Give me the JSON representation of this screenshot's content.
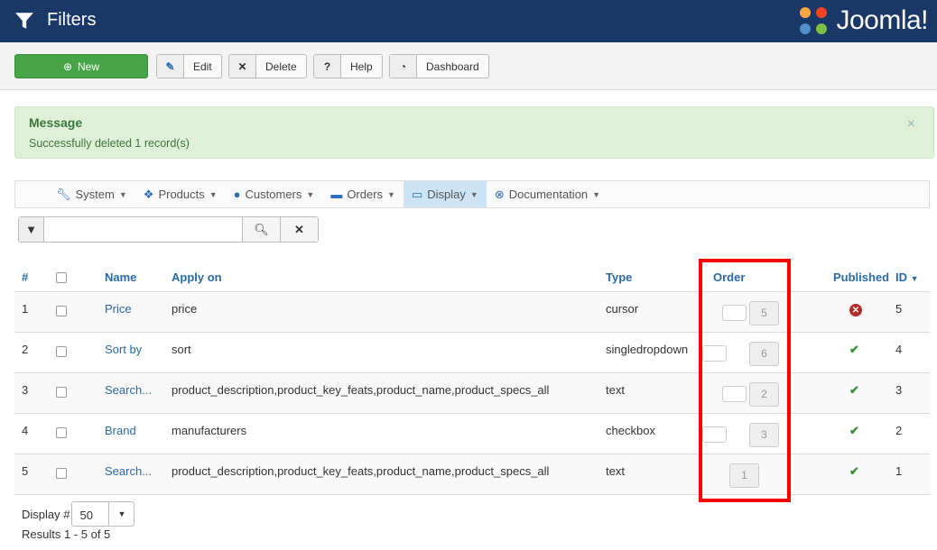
{
  "header": {
    "title": "Filters",
    "logo_text": "Joomla!"
  },
  "toolbar": {
    "new": "New",
    "edit": "Edit",
    "delete": "Delete",
    "help": "Help",
    "dashboard": "Dashboard"
  },
  "message": {
    "heading": "Message",
    "body": "Successfully deleted 1 record(s)",
    "close": "×"
  },
  "nav": [
    {
      "label": "System",
      "icon": "wrench-icon"
    },
    {
      "label": "Products",
      "icon": "cubes-icon"
    },
    {
      "label": "Customers",
      "icon": "user-icon"
    },
    {
      "label": "Orders",
      "icon": "credit-card-icon"
    },
    {
      "label": "Display",
      "icon": "monitor-icon",
      "active": true
    },
    {
      "label": "Documentation",
      "icon": "lifebuoy-icon"
    }
  ],
  "search": {
    "value": "",
    "placeholder": ""
  },
  "table": {
    "headers": {
      "num": "#",
      "name": "Name",
      "apply": "Apply on",
      "type": "Type",
      "order": "Order",
      "published": "Published",
      "id": "ID"
    },
    "rows": [
      {
        "num": "1",
        "name": "Price",
        "apply": "price",
        "type": "cursor",
        "order": "5",
        "published": false,
        "id": "5"
      },
      {
        "num": "2",
        "name": "Sort by",
        "apply": "sort",
        "type": "singledropdown",
        "order": "6",
        "published": true,
        "id": "4"
      },
      {
        "num": "3",
        "name": "Search...",
        "apply": "product_description,product_key_feats,product_name,product_specs_all",
        "type": "text",
        "order": "2",
        "published": true,
        "id": "3"
      },
      {
        "num": "4",
        "name": "Brand",
        "apply": "manufacturers",
        "type": "checkbox",
        "order": "3",
        "published": true,
        "id": "2"
      },
      {
        "num": "5",
        "name": "Search...",
        "apply": "product_description,product_key_feats,product_name,product_specs_all",
        "type": "text",
        "order": "1",
        "published": true,
        "id": "1"
      }
    ]
  },
  "footer": {
    "display_label": "Display #",
    "display_value": "50",
    "results": "Results 1 - 5 of 5"
  },
  "colors": {
    "header": "#1a3867",
    "new": "#46a546",
    "link": "#2a6aa8",
    "ok": "#3b8f3b",
    "err": "#b52a2a",
    "highlight": "#ff0000"
  }
}
